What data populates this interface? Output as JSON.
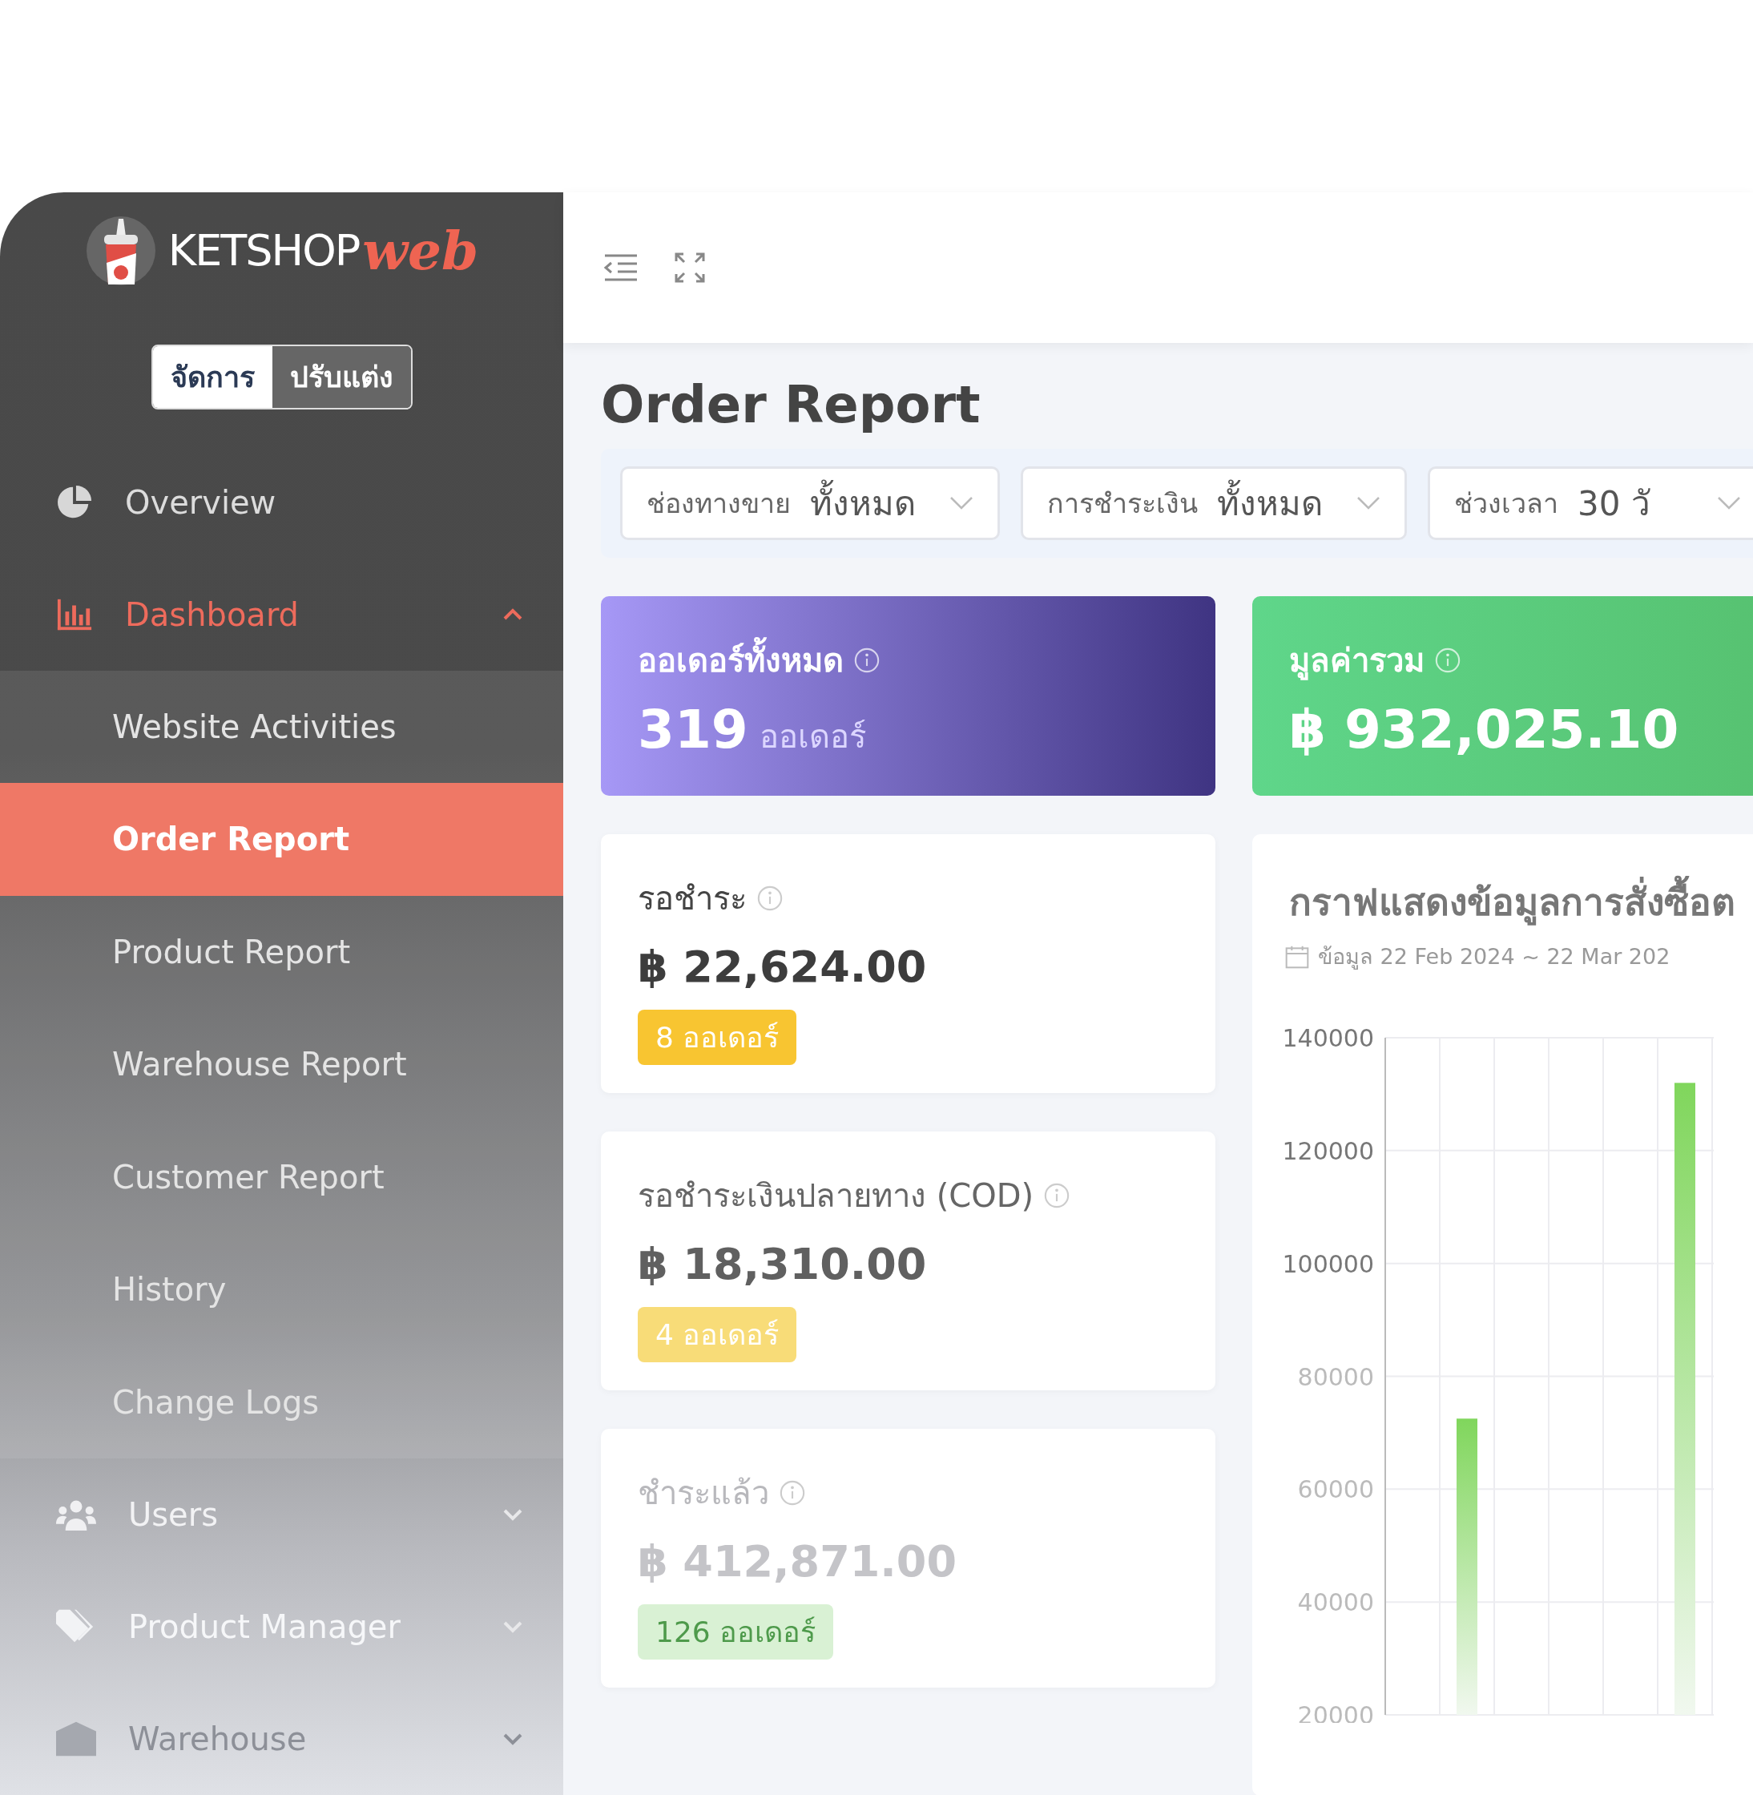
{
  "sidebar": {
    "logo": {
      "text": "KETSHOP",
      "accent": "web"
    },
    "mode_toggle": [
      {
        "label": "จัดการ",
        "selected": true
      },
      {
        "label": "ปรับแต่ง",
        "selected": false
      }
    ],
    "menu": [
      {
        "label": "Overview"
      },
      {
        "label": "Dashboard",
        "expanded": true,
        "children": [
          {
            "label": "Website Activities",
            "selected": false
          },
          {
            "label": "Order Report",
            "selected": true
          },
          {
            "label": "Product Report",
            "selected": false
          },
          {
            "label": "Warehouse Report",
            "selected": false
          },
          {
            "label": "Customer Report",
            "selected": false
          },
          {
            "label": "History",
            "selected": false
          },
          {
            "label": "Change Logs",
            "selected": false
          }
        ]
      },
      {
        "label": "Users",
        "expanded": false
      },
      {
        "label": "Product Manager",
        "expanded": false
      },
      {
        "label": "Warehouse",
        "expanded": false
      }
    ]
  },
  "page_title": "Order Report",
  "filters": [
    {
      "label": "ช่องทางขาย",
      "value": "ทั้งหมด"
    },
    {
      "label": "การชำระเงิน",
      "value": "ทั้งหมด"
    },
    {
      "label": "ช่วงเวลา",
      "value": "30 วั"
    }
  ],
  "summary": [
    {
      "kind": "count",
      "title": "ออเดอร์ทั้งหมด",
      "value": "319",
      "unit": "ออเดอร์"
    },
    {
      "kind": "amount",
      "title": "มูลค่ารวม",
      "value": "฿ 932,025.10"
    }
  ],
  "status_cards": [
    {
      "title": "รอชำระ",
      "amount": "฿ 22,624.00",
      "badge": "8 ออเดอร์",
      "color": "#f8c531"
    },
    {
      "title": "รอชำระเงินปลายทาง (COD)",
      "amount": "฿ 18,310.00",
      "badge": "4 ออเดอร์",
      "color": "#f8dc78"
    },
    {
      "title": "ชำระแล้ว",
      "amount": "฿ 412,871.00",
      "badge": "126 ออเดอร์",
      "color": "#d9f1d4"
    }
  ],
  "chart": {
    "title": "กราฟแสดงข้อมูลการสั่งซื้อต",
    "date_range": "ข้อมูล 22 Feb 2024 ~ 22 Mar 202",
    "chart_data": {
      "type": "bar",
      "grid": true,
      "values": [
        null,
        72500,
        null,
        null,
        null,
        132000
      ],
      "ylim": [
        20000,
        140000
      ],
      "yticks": [
        20000,
        40000,
        60000,
        80000,
        100000,
        120000,
        140000
      ]
    }
  }
}
